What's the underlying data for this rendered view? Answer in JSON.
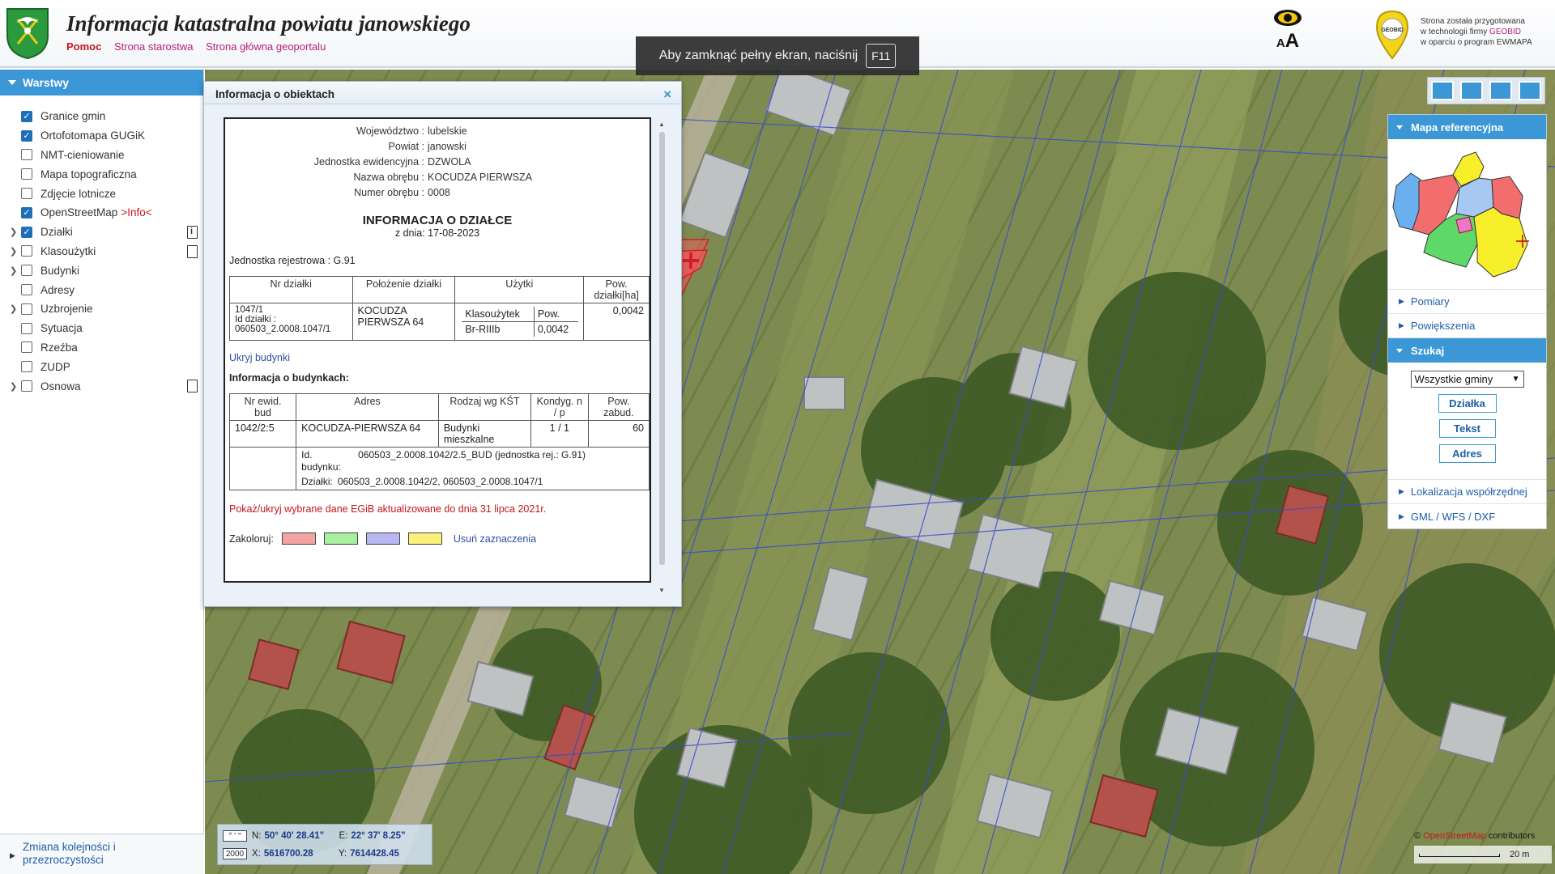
{
  "header": {
    "title": "Informacja katastralna powiatu janowskiego",
    "links": [
      "Pomoc",
      "Strona starostwa",
      "Strona główna geoportalu"
    ],
    "a11y_label": "AA",
    "geobid_note_lines": [
      "Strona została przygotowana",
      "w technologii firmy",
      "GEOBID",
      "w oparciu o program EWMAPA"
    ],
    "geobid_logo_text": "GEOBID"
  },
  "fullscreen_tip": {
    "text": "Aby zamknąć pełny ekran, naciśnij",
    "key": "F11"
  },
  "layers_panel": {
    "title": "Warstwy",
    "items": [
      {
        "label": "Granice gmin",
        "checked": true,
        "expandable": false,
        "icon": ""
      },
      {
        "label": "Ortofotomapa GUGiK",
        "checked": true,
        "expandable": false,
        "icon": ""
      },
      {
        "label": "NMT-cieniowanie",
        "checked": false,
        "expandable": false,
        "icon": ""
      },
      {
        "label": "Mapa topograficzna",
        "checked": false,
        "expandable": false,
        "icon": ""
      },
      {
        "label": "Zdjęcie lotnicze",
        "checked": false,
        "expandable": false,
        "icon": ""
      },
      {
        "label": "OpenStreetMap",
        "checked": true,
        "expandable": false,
        "icon": "",
        "extra": ">Info<"
      },
      {
        "label": "Działki",
        "checked": true,
        "expandable": true,
        "icon": "info-doc-icon"
      },
      {
        "label": "Klasoużytki",
        "checked": false,
        "expandable": true,
        "icon": "doc-icon"
      },
      {
        "label": "Budynki",
        "checked": false,
        "expandable": true,
        "icon": ""
      },
      {
        "label": "Adresy",
        "checked": false,
        "expandable": false,
        "icon": ""
      },
      {
        "label": "Uzbrojenie",
        "checked": false,
        "expandable": true,
        "icon": ""
      },
      {
        "label": "Sytuacja",
        "checked": false,
        "expandable": false,
        "icon": ""
      },
      {
        "label": "Rzeźba",
        "checked": false,
        "expandable": false,
        "icon": ""
      },
      {
        "label": "ZUDP",
        "checked": false,
        "expandable": false,
        "icon": ""
      },
      {
        "label": "Osnowa",
        "checked": false,
        "expandable": true,
        "icon": "doc-icon"
      }
    ],
    "order_link": "Zmiana kolejności i przezroczystości"
  },
  "info_window": {
    "title": "Informacja o obiektach",
    "close": "×",
    "meta": [
      {
        "k": "Województwo :",
        "v": "lubelskie"
      },
      {
        "k": "Powiat :",
        "v": "janowski"
      },
      {
        "k": "Jednostka ewidencyjna :",
        "v": "DZWOLA"
      },
      {
        "k": "Nazwa obrębu :",
        "v": "KOCUDZA PIERWSZA"
      },
      {
        "k": "Numer obrębu :",
        "v": "0008"
      }
    ],
    "doc_title": "INFORMACJA O DZIAŁCE",
    "doc_date": "z dnia: 17-08-2023",
    "registry_unit": "Jednostka rejestrowa : G.91",
    "parcel_table": {
      "headers": [
        "Nr działki",
        "Położenie działki",
        "Użytki",
        "Pow. działki[ha]"
      ],
      "nr": "1047/1",
      "id_label": "Id działki :",
      "id": "060503_2.0008.1047/1",
      "location": "KOCUDZA PIERWSZA 64",
      "use_headers": [
        "Klasoużytek",
        "Pow."
      ],
      "use_class": "Br-RIIIb",
      "use_area": "0,0042",
      "area": "0,0042"
    },
    "hide_buildings": "Ukryj budynki",
    "buildings_title": "Informacja o budynkach:",
    "building_table": {
      "headers": [
        "Nr ewid. bud",
        "Adres",
        "Rodzaj wg KŚT",
        "Kondyg. n / p",
        "Pow. zabud."
      ],
      "nr": "1042/2:5",
      "address": "KOCUDZA-PIERWSZA 64",
      "type": "Budynki mieszkalne",
      "floors": "1 / 1",
      "area": "60",
      "bid_label": "Id. budynku:",
      "bid": "060503_2.0008.1042/2.5_BUD (jednostka rej.: G.91)",
      "plots_label": "Działki:",
      "plots": "060503_2.0008.1042/2, 060503_2.0008.1047/1"
    },
    "egib_note": "Pokaż/ukryj wybrane dane EGiB aktualizowane do dnia 31 lipca 2021r.",
    "colorize_label": "Zakoloruj:",
    "swatches": [
      "#f4a3a3",
      "#a8f0a0",
      "#b9b6f4",
      "#fbf07a"
    ],
    "clear_label": "Usuń zaznaczenia"
  },
  "right_panel": {
    "ref_map_title": "Mapa referencyjna",
    "items_top": [
      "Pomiary",
      "Powiększenia"
    ],
    "search_title": "Szukaj",
    "gmina_select": "Wszystkie gminy",
    "search_buttons": [
      "Działka",
      "Tekst",
      "Adres"
    ],
    "items_bottom": [
      "Lokalizacja współrzędnej",
      "GML / WFS / DXF"
    ],
    "ref_colors": [
      "#6bb0ee",
      "#f26e6e",
      "#f7ef2a",
      "#5fd86a",
      "#a7c8f2"
    ]
  },
  "coords": {
    "dms_btn": "° ' \"",
    "epsg_btn": "2000",
    "n_label": "N:",
    "n_val": "50° 40' 28.41\"",
    "e_label": "E:",
    "e_val": "22° 37' 8.25\"",
    "x_label": "X:",
    "x_val": "5616700.28",
    "y_label": "Y:",
    "y_val": "7614428.45"
  },
  "attribution": {
    "prefix": "© ",
    "osm": "OpenStreetMap",
    "suffix": " contributors"
  },
  "scale": "20 m"
}
